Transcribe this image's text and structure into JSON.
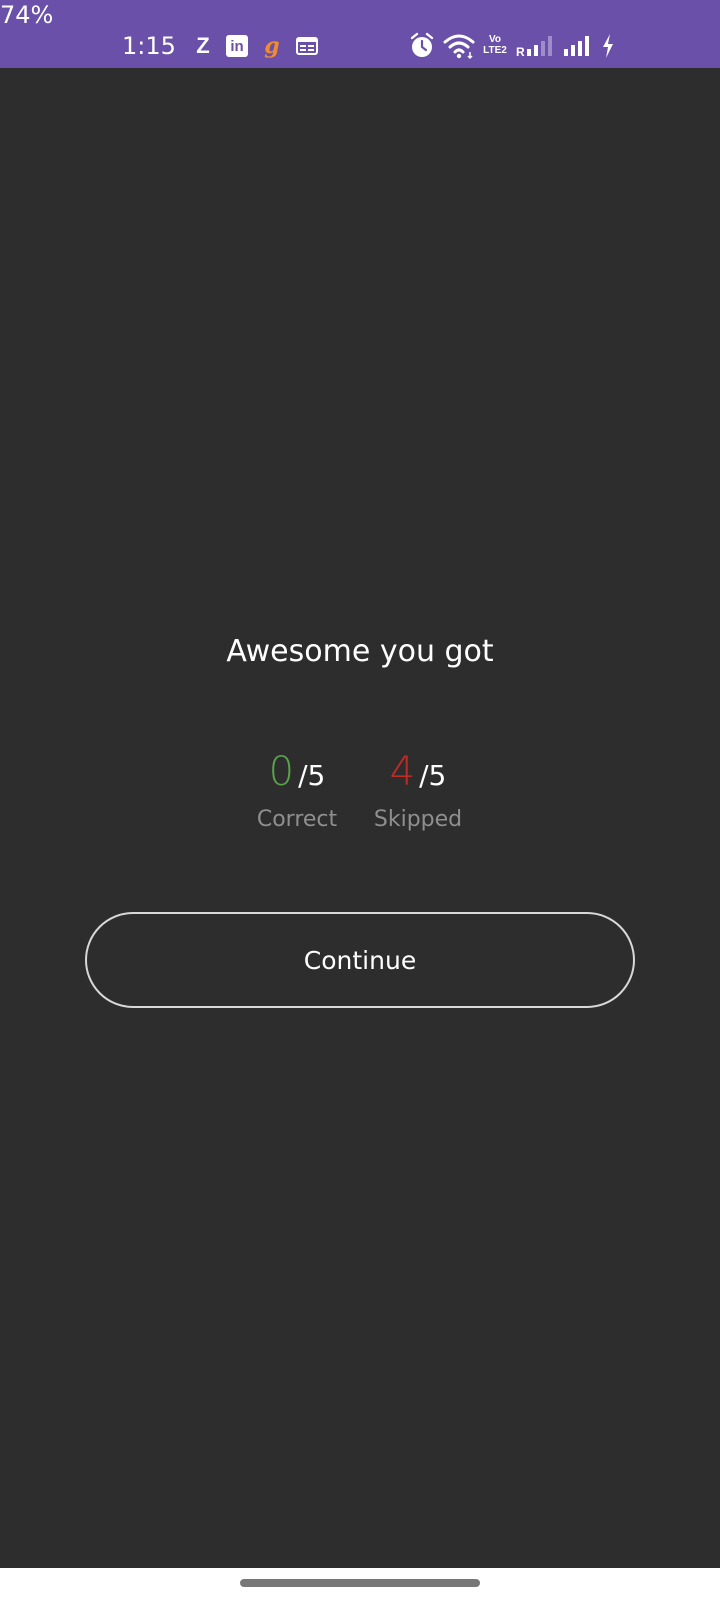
{
  "status_bar": {
    "time": "1:15",
    "apps": [
      "z-icon",
      "linkedin-icon",
      "goodreads-icon",
      "calendar-icon"
    ],
    "z_label": "Z",
    "linkedin_label": "in",
    "g_label": "g",
    "volte_line1": "Vo",
    "volte_line2": "LTE2",
    "sim_label": "R",
    "battery": "74%",
    "background": "#6a50a8"
  },
  "main": {
    "heading": "Awesome you got",
    "correct": {
      "value": "0",
      "total": "/5",
      "label": "Correct",
      "color": "#5aa24c"
    },
    "skipped": {
      "value": "4",
      "total": "/5",
      "label": "Skipped",
      "color": "#bf2b26"
    },
    "continue_label": "Continue",
    "background": "#2d2d2d"
  }
}
